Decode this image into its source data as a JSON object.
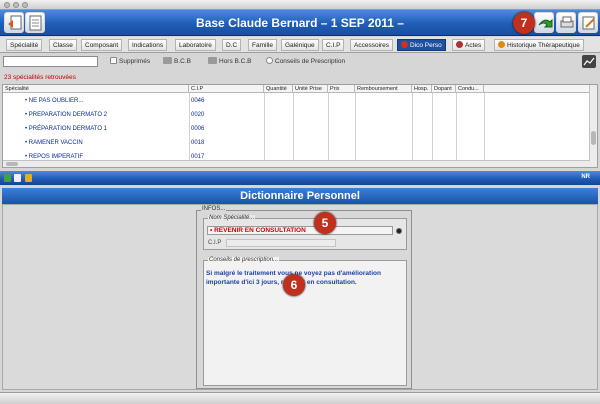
{
  "window": {
    "title": "Base Claude Bernard – 1 SEP 2011 –"
  },
  "tabs": [
    {
      "label": "Spécialité"
    },
    {
      "label": "Classe"
    },
    {
      "label": "Composant"
    },
    {
      "label": "Indications"
    },
    {
      "label": "Laboratoire"
    },
    {
      "label": "D.C"
    },
    {
      "label": "Famille"
    },
    {
      "label": "Galénique"
    },
    {
      "label": "C.I.P"
    },
    {
      "label": "Accessoires"
    },
    {
      "label": "Dico Perso"
    },
    {
      "label": "Actes"
    },
    {
      "label": "Historique Thérapeutique"
    }
  ],
  "toolbar": {
    "search_value": "",
    "supprimes_label": "Supprimés",
    "bcb_label": "B.C.B",
    "hors_bcb_label": "Hors B.C.B",
    "conseils_label": "Conseils de Prescription"
  },
  "results_count": "23 spécialités retrouvées",
  "table": {
    "headers": [
      "Spécialité",
      "C.I.P",
      "Quantité",
      "Unité Prise",
      "Prix",
      "Remboursement",
      "Hosp.",
      "Dopant",
      "Condu..."
    ],
    "rows": [
      {
        "spec": "• NE PAS OUBLIER...",
        "cip": "0046"
      },
      {
        "spec": "• PREPARATION DERMATO 2",
        "cip": "0020"
      },
      {
        "spec": "• PRÉPARATION DERMATO 1",
        "cip": "0006"
      },
      {
        "spec": "• RAMENER VACCIN",
        "cip": "0018"
      },
      {
        "spec": "• REPOS IMPERATIF",
        "cip": "0017"
      }
    ]
  },
  "status": {
    "right_label": "NR"
  },
  "dictionary": {
    "title": "Dictionnaire Personnel",
    "infos_legend": "INFOS...",
    "name_legend": "Nom Spécialité...",
    "name_value": "• REVENIR EN CONSULTATION",
    "cip_label": "C.I.P",
    "cip_value": "",
    "conseils_legend": "Conseils de prescription...",
    "conseils_text": "Si malgré le traitement vous ne voyez pas d'amélioration importante d'ici 3 jours, revenez en consultation."
  },
  "badges": {
    "b5": "5",
    "b6": "6",
    "b7": "7"
  },
  "colors": {
    "accent_blue": "#1f5db8",
    "count_red": "#c00000",
    "badge_red": "#c0301d",
    "link_blue": "#0a2c8a"
  }
}
